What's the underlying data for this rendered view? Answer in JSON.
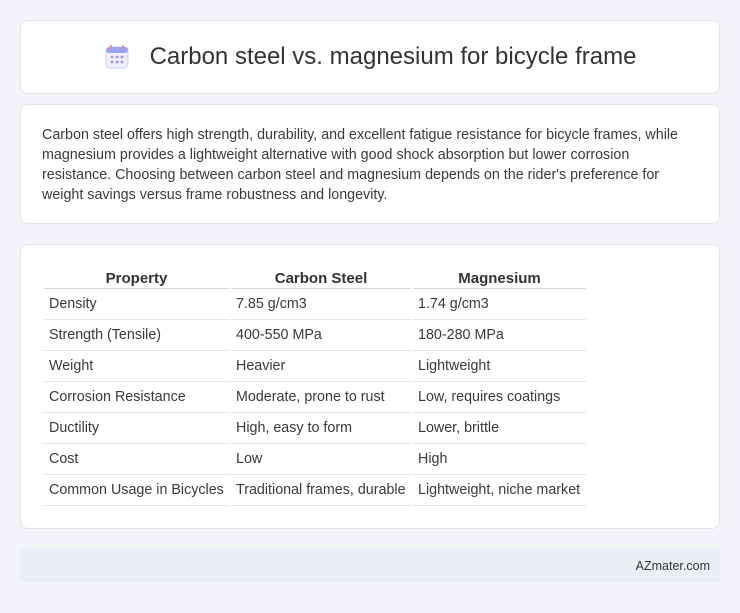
{
  "header": {
    "title": "Carbon steel vs. magnesium for bicycle frame",
    "icon": "calendar-icon"
  },
  "summary": {
    "text": "Carbon steel offers high strength, durability, and excellent fatigue resistance for bicycle frames, while magnesium provides a lightweight alternative with good shock absorption but lower corrosion resistance. Choosing between carbon steel and magnesium depends on the rider's preference for weight savings versus frame robustness and longevity."
  },
  "table": {
    "headers": [
      "Property",
      "Carbon Steel",
      "Magnesium"
    ],
    "rows": [
      [
        "Density",
        "7.85 g/cm3",
        "1.74 g/cm3"
      ],
      [
        "Strength (Tensile)",
        "400-550 MPa",
        "180-280 MPa"
      ],
      [
        "Weight",
        "Heavier",
        "Lightweight"
      ],
      [
        "Corrosion Resistance",
        "Moderate, prone to rust",
        "Low, requires coatings"
      ],
      [
        "Ductility",
        "High, easy to form",
        "Lower, brittle"
      ],
      [
        "Cost",
        "Low",
        "High"
      ],
      [
        "Common Usage in Bicycles",
        "Traditional frames, durable",
        "Lightweight, niche market"
      ]
    ]
  },
  "footer": {
    "brand": "AZmater.com"
  },
  "colors": {
    "background": "#f3f4f7",
    "card": "#ffffff",
    "footer": "#e9eef8",
    "icon_accent": "#8b7cf6"
  }
}
